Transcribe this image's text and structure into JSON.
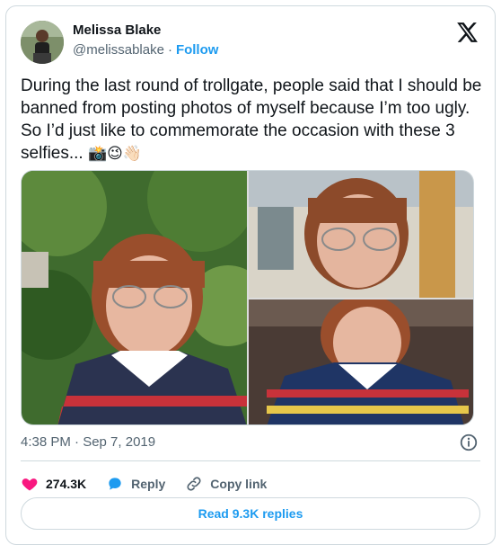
{
  "author": {
    "name": "Melissa Blake",
    "handle": "@melissablake",
    "separator": "·",
    "follow_label": "Follow"
  },
  "tweet": {
    "text": "During the last round of trollgate, people said that I should be banned from posting photos of myself because I’m too ugly. So I’d just like to commemorate the occasion with these 3 selfies...",
    "emojis": [
      "📸",
      "😉",
      "👋🏻"
    ]
  },
  "media": {
    "photo_count": 3
  },
  "meta": {
    "timestamp": "4:38 PM · Sep 7, 2019"
  },
  "actions": {
    "likes": "274.3K",
    "reply_label": "Reply",
    "copy_link_label": "Copy link"
  },
  "footer": {
    "read_replies_label": "Read 9.3K replies"
  },
  "colors": {
    "accent": "#1d9bf0",
    "like": "#f91880",
    "text": "#0f1419",
    "secondary": "#536471",
    "border": "#cfd9de"
  },
  "icons": {
    "logo": "x-logo-icon",
    "info": "info-icon",
    "like": "heart-icon",
    "reply": "reply-bubble-icon",
    "copy": "link-icon"
  }
}
